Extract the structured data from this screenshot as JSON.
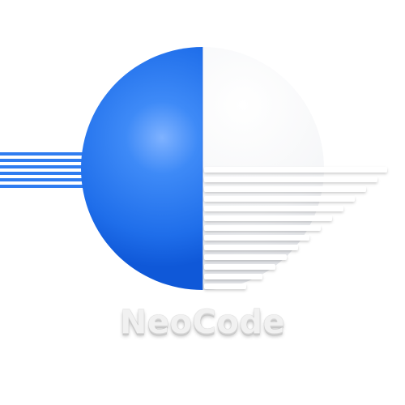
{
  "brand": {
    "name": "NeoCode"
  },
  "colors": {
    "blue": "#2f7cf0",
    "blue_dark": "#0d55d6",
    "white_face": "#f6f7f9",
    "stripe": "#ffffff"
  }
}
